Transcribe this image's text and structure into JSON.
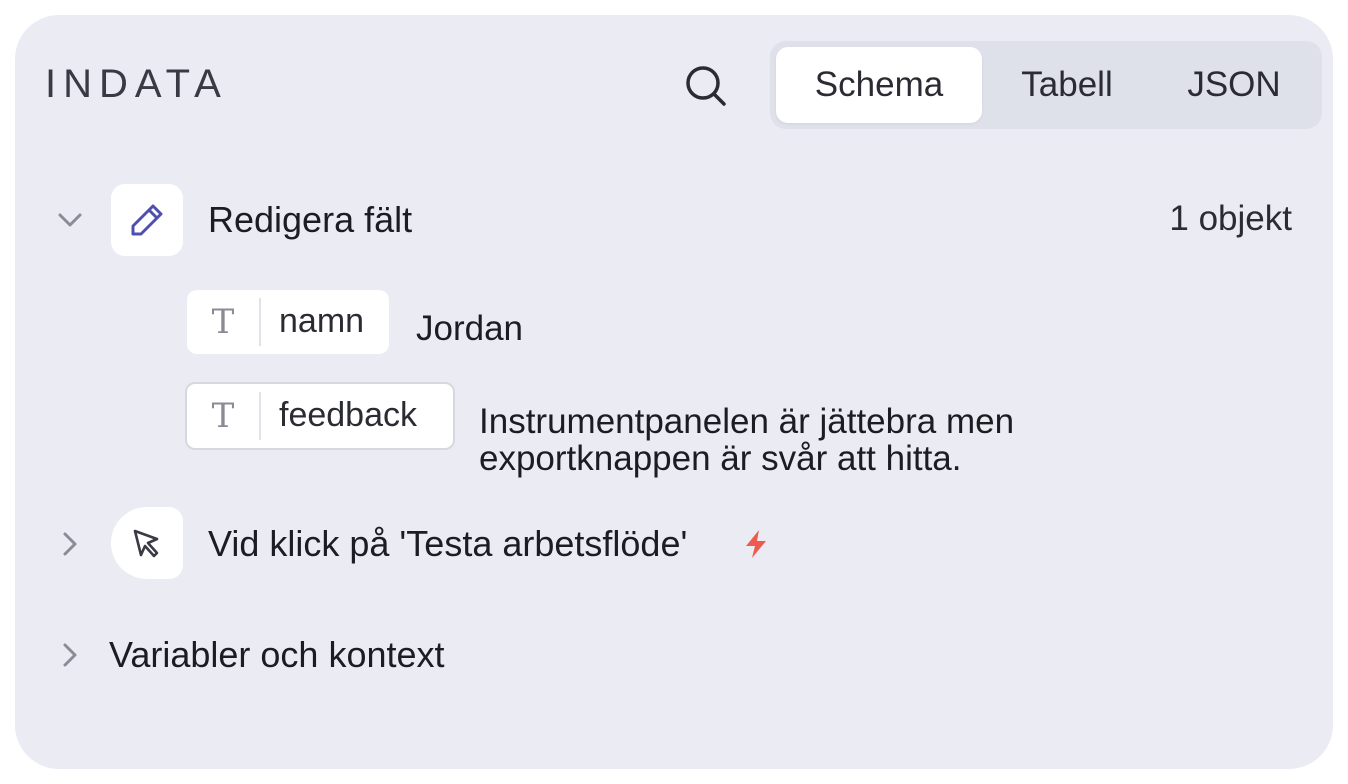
{
  "panel": {
    "title": "INDATA",
    "search_icon": "search-icon"
  },
  "tabs": [
    {
      "label": "Schema",
      "active": true
    },
    {
      "label": "Tabell",
      "active": false
    },
    {
      "label": "JSON",
      "active": false
    }
  ],
  "edit_fields": {
    "label": "Redigera fält",
    "count": "1 objekt",
    "icon": "pencil-icon",
    "expanded": true,
    "fields": [
      {
        "type_icon": "T",
        "name": "namn",
        "value": "Jordan"
      },
      {
        "type_icon": "T",
        "name": "feedback",
        "value_line1": "Instrumentpanelen är jättebra men",
        "value_line2": "exportknappen är svår att hitta."
      }
    ]
  },
  "trigger": {
    "label": "Vid klick på 'Testa arbetsflöde'",
    "icon": "cursor-click-icon",
    "badge_icon": "lightning-icon",
    "badge_color": "#ee5a4f",
    "expanded": false
  },
  "variables": {
    "label": "Variabler och kontext",
    "expanded": false
  },
  "colors": {
    "panel_bg": "#ebecf3",
    "accent_pencil": "#4f4fb0",
    "lightning": "#ee5a4f"
  }
}
